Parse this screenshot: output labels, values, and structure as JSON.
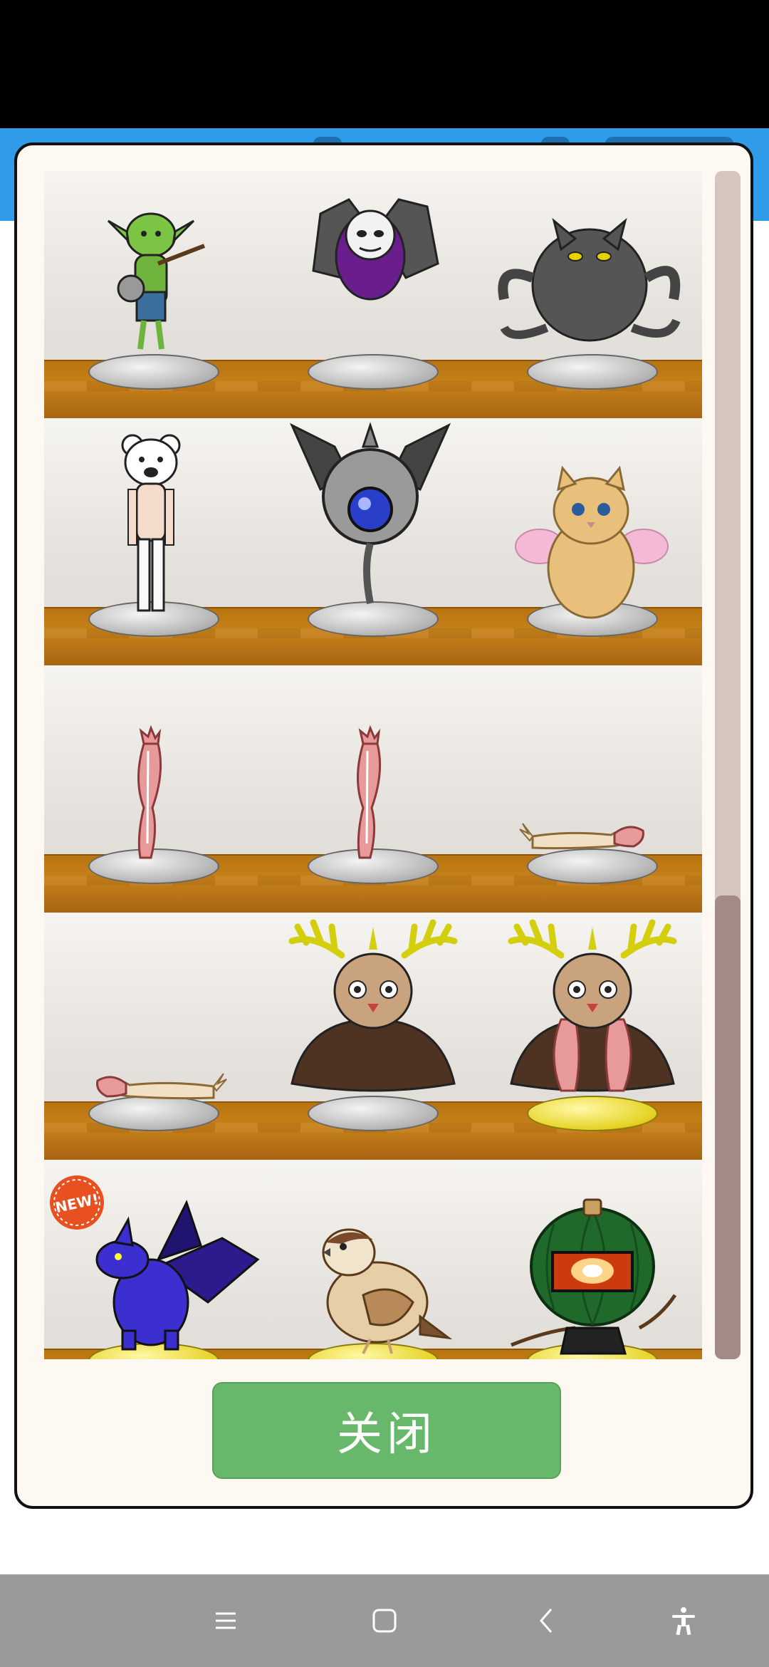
{
  "dialog": {
    "close_label": "关闭",
    "new_badge": "NEW!"
  },
  "shelves": [
    {
      "items": [
        {
          "name": "goblin-figure",
          "pedestal": "silver"
        },
        {
          "name": "masked-bat-figure",
          "pedestal": "silver"
        },
        {
          "name": "gray-cat-figure",
          "pedestal": "silver"
        }
      ]
    },
    {
      "items": [
        {
          "name": "bear-man-figure",
          "pedestal": "silver"
        },
        {
          "name": "eye-orb-bat-figure",
          "pedestal": "silver"
        },
        {
          "name": "winged-kitten-figure",
          "pedestal": "silver"
        }
      ]
    },
    {
      "items": [
        {
          "name": "muscle-leg-figure",
          "pedestal": "silver"
        },
        {
          "name": "muscle-leg-figure-2",
          "pedestal": "silver"
        },
        {
          "name": "muscle-arm-figure",
          "pedestal": "silver"
        }
      ]
    },
    {
      "items": [
        {
          "name": "muscle-arm-figure-2",
          "pedestal": "silver"
        },
        {
          "name": "antlered-beast-bust-figure",
          "pedestal": "silver"
        },
        {
          "name": "antlered-beast-full-figure",
          "pedestal": "gold"
        }
      ]
    },
    {
      "items": [
        {
          "name": "blue-dragon-figure",
          "pedestal": "gold",
          "is_new": true
        },
        {
          "name": "sparrow-figure",
          "pedestal": "gold"
        },
        {
          "name": "pumpkin-figure",
          "pedestal": "gold"
        }
      ]
    }
  ],
  "scrollbar": {
    "position_fraction": 0.61,
    "thumb_fraction": 0.39
  },
  "colors": {
    "close_button": "#67b86b",
    "shelf_board": "#c7811a",
    "header_strip": "#2f9be9",
    "nav_bar": "#9a9a9a"
  },
  "nav_bar": {
    "icons": [
      "menu-icon",
      "home-icon",
      "back-icon",
      "accessibility-icon"
    ]
  }
}
